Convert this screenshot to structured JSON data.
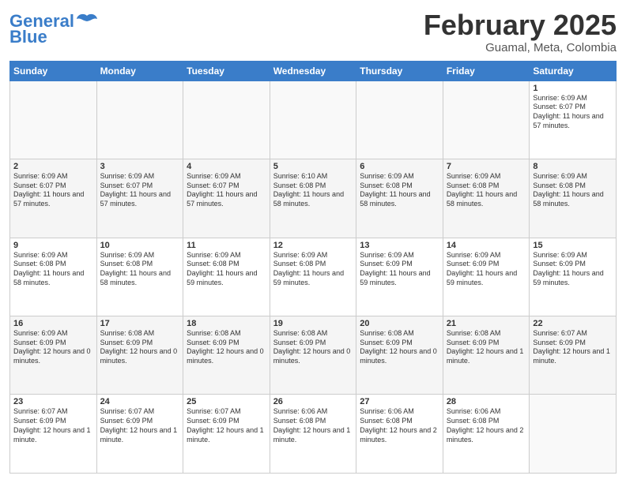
{
  "logo": {
    "text1": "General",
    "text2": "Blue"
  },
  "title": "February 2025",
  "location": "Guamal, Meta, Colombia",
  "days_of_week": [
    "Sunday",
    "Monday",
    "Tuesday",
    "Wednesday",
    "Thursday",
    "Friday",
    "Saturday"
  ],
  "weeks": [
    [
      {
        "day": "",
        "info": ""
      },
      {
        "day": "",
        "info": ""
      },
      {
        "day": "",
        "info": ""
      },
      {
        "day": "",
        "info": ""
      },
      {
        "day": "",
        "info": ""
      },
      {
        "day": "",
        "info": ""
      },
      {
        "day": "1",
        "info": "Sunrise: 6:09 AM\nSunset: 6:07 PM\nDaylight: 11 hours and 57 minutes."
      }
    ],
    [
      {
        "day": "2",
        "info": "Sunrise: 6:09 AM\nSunset: 6:07 PM\nDaylight: 11 hours and 57 minutes."
      },
      {
        "day": "3",
        "info": "Sunrise: 6:09 AM\nSunset: 6:07 PM\nDaylight: 11 hours and 57 minutes."
      },
      {
        "day": "4",
        "info": "Sunrise: 6:09 AM\nSunset: 6:07 PM\nDaylight: 11 hours and 57 minutes."
      },
      {
        "day": "5",
        "info": "Sunrise: 6:10 AM\nSunset: 6:08 PM\nDaylight: 11 hours and 58 minutes."
      },
      {
        "day": "6",
        "info": "Sunrise: 6:09 AM\nSunset: 6:08 PM\nDaylight: 11 hours and 58 minutes."
      },
      {
        "day": "7",
        "info": "Sunrise: 6:09 AM\nSunset: 6:08 PM\nDaylight: 11 hours and 58 minutes."
      },
      {
        "day": "8",
        "info": "Sunrise: 6:09 AM\nSunset: 6:08 PM\nDaylight: 11 hours and 58 minutes."
      }
    ],
    [
      {
        "day": "9",
        "info": "Sunrise: 6:09 AM\nSunset: 6:08 PM\nDaylight: 11 hours and 58 minutes."
      },
      {
        "day": "10",
        "info": "Sunrise: 6:09 AM\nSunset: 6:08 PM\nDaylight: 11 hours and 58 minutes."
      },
      {
        "day": "11",
        "info": "Sunrise: 6:09 AM\nSunset: 6:08 PM\nDaylight: 11 hours and 59 minutes."
      },
      {
        "day": "12",
        "info": "Sunrise: 6:09 AM\nSunset: 6:08 PM\nDaylight: 11 hours and 59 minutes."
      },
      {
        "day": "13",
        "info": "Sunrise: 6:09 AM\nSunset: 6:09 PM\nDaylight: 11 hours and 59 minutes."
      },
      {
        "day": "14",
        "info": "Sunrise: 6:09 AM\nSunset: 6:09 PM\nDaylight: 11 hours and 59 minutes."
      },
      {
        "day": "15",
        "info": "Sunrise: 6:09 AM\nSunset: 6:09 PM\nDaylight: 11 hours and 59 minutes."
      }
    ],
    [
      {
        "day": "16",
        "info": "Sunrise: 6:09 AM\nSunset: 6:09 PM\nDaylight: 12 hours and 0 minutes."
      },
      {
        "day": "17",
        "info": "Sunrise: 6:08 AM\nSunset: 6:09 PM\nDaylight: 12 hours and 0 minutes."
      },
      {
        "day": "18",
        "info": "Sunrise: 6:08 AM\nSunset: 6:09 PM\nDaylight: 12 hours and 0 minutes."
      },
      {
        "day": "19",
        "info": "Sunrise: 6:08 AM\nSunset: 6:09 PM\nDaylight: 12 hours and 0 minutes."
      },
      {
        "day": "20",
        "info": "Sunrise: 6:08 AM\nSunset: 6:09 PM\nDaylight: 12 hours and 0 minutes."
      },
      {
        "day": "21",
        "info": "Sunrise: 6:08 AM\nSunset: 6:09 PM\nDaylight: 12 hours and 1 minute."
      },
      {
        "day": "22",
        "info": "Sunrise: 6:07 AM\nSunset: 6:09 PM\nDaylight: 12 hours and 1 minute."
      }
    ],
    [
      {
        "day": "23",
        "info": "Sunrise: 6:07 AM\nSunset: 6:09 PM\nDaylight: 12 hours and 1 minute."
      },
      {
        "day": "24",
        "info": "Sunrise: 6:07 AM\nSunset: 6:09 PM\nDaylight: 12 hours and 1 minute."
      },
      {
        "day": "25",
        "info": "Sunrise: 6:07 AM\nSunset: 6:09 PM\nDaylight: 12 hours and 1 minute."
      },
      {
        "day": "26",
        "info": "Sunrise: 6:06 AM\nSunset: 6:08 PM\nDaylight: 12 hours and 1 minute."
      },
      {
        "day": "27",
        "info": "Sunrise: 6:06 AM\nSunset: 6:08 PM\nDaylight: 12 hours and 2 minutes."
      },
      {
        "day": "28",
        "info": "Sunrise: 6:06 AM\nSunset: 6:08 PM\nDaylight: 12 hours and 2 minutes."
      },
      {
        "day": "",
        "info": ""
      }
    ]
  ]
}
